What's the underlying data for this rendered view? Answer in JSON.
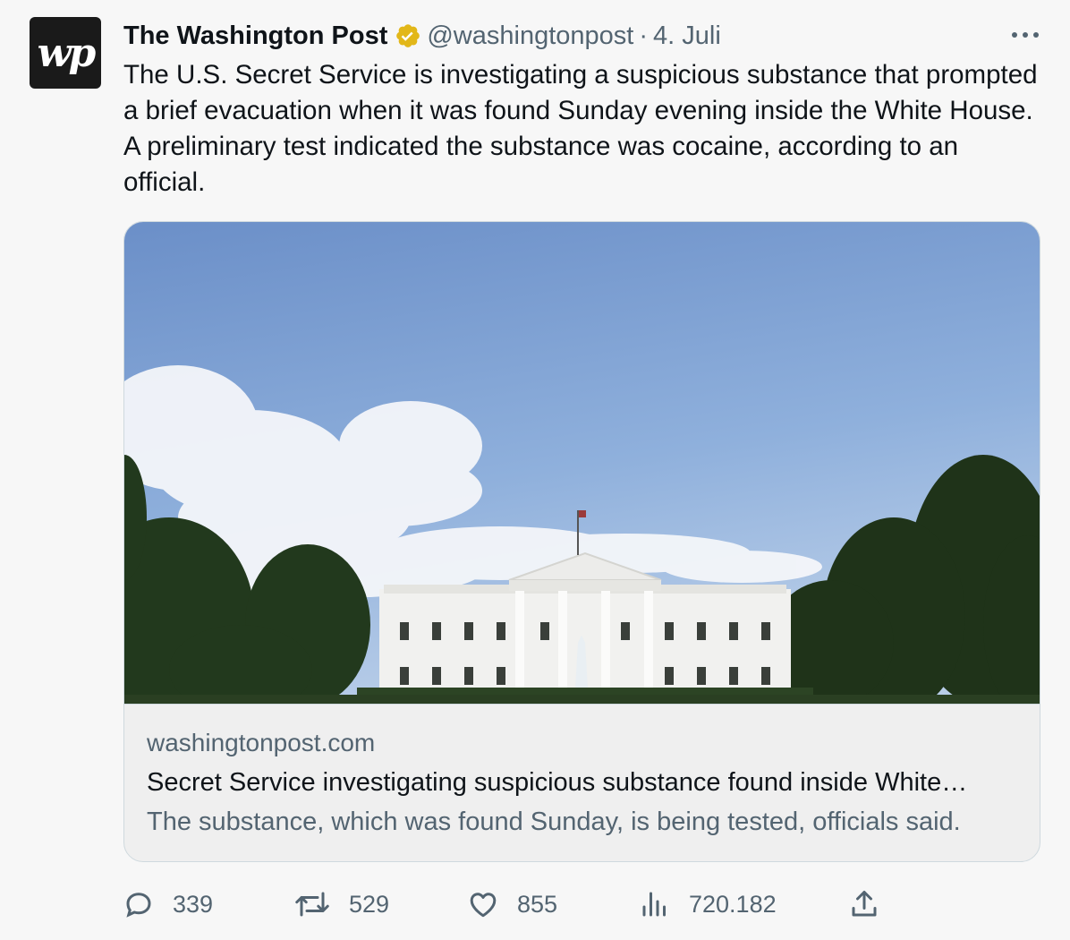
{
  "author": {
    "logo_text": "wp",
    "name": "The Washington Post",
    "handle": "@washingtonpost",
    "separator": "·",
    "date": "4. Juli",
    "verified_icon": "verified-badge-icon",
    "verified_color": "#e2b719"
  },
  "tweet": {
    "text": "The U.S. Secret Service is investigating a suspicious substance that prompted a brief evacuation when it was found Sunday evening inside the White House. A preliminary test indicated the substance was cocaine, according to an official."
  },
  "card": {
    "domain": "washingtonpost.com",
    "title": "Secret Service investigating suspicious substance found inside White…",
    "description": "The substance, which was found Sunday, is being tested, officials said."
  },
  "actions": {
    "replies": "339",
    "retweets": "529",
    "likes": "855",
    "views": "720.182"
  },
  "colors": {
    "text": "#0f1419",
    "secondary": "#536471",
    "border": "#cfd9de",
    "background": "#f7f7f7"
  }
}
